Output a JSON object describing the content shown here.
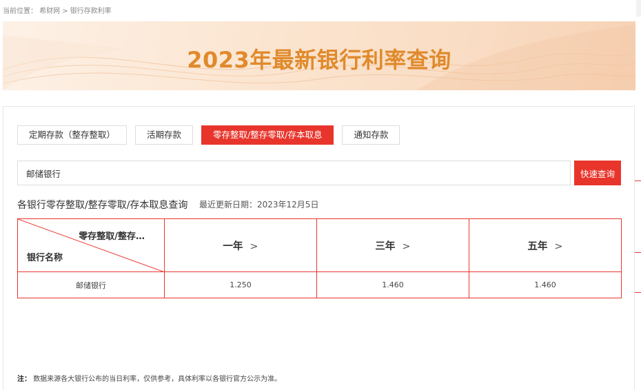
{
  "breadcrumb": {
    "prefix": "当前位置：",
    "items": [
      "希财网",
      "银行存款利率"
    ],
    "separator": ">"
  },
  "banner": {
    "title": "2023年最新银行利率查询"
  },
  "tabs": [
    {
      "label": "定期存款（整存整取）",
      "active": false
    },
    {
      "label": "活期存款",
      "active": false
    },
    {
      "label": "零存整取/整存零取/存本取息",
      "active": true
    },
    {
      "label": "通知存款",
      "active": false
    }
  ],
  "search": {
    "value": "邮储银行",
    "button_label": "快速查询"
  },
  "section": {
    "title": "各银行零存整取/整存零取/存本取息查询",
    "update_date": "最近更新日期：2023年12月5日"
  },
  "table": {
    "corner_top": "零存整取/整存…",
    "corner_bottom": "银行名称",
    "columns": [
      "一年",
      "三年",
      "五年"
    ],
    "chevron": ">",
    "rows": [
      {
        "bank": "邮储银行",
        "rates": [
          "1.250",
          "1.460",
          "1.460"
        ]
      }
    ]
  },
  "note": {
    "label": "注：",
    "text": "数据来源各大银行公布的当日利率，仅供参考，具体利率以各银行官方公示为准。"
  },
  "colors": {
    "accent": "#e8352c",
    "banner_title": "#e08a2c"
  }
}
